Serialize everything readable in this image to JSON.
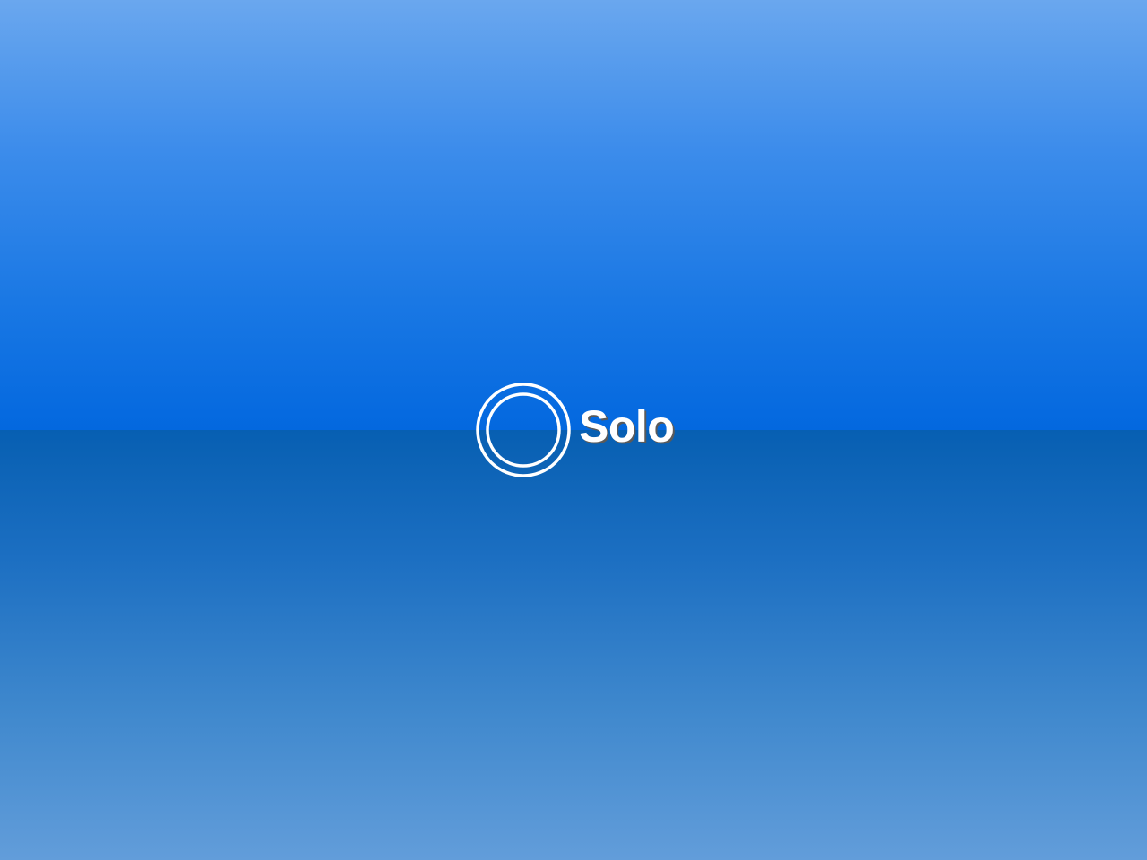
{
  "brand": {
    "name": "Solo"
  },
  "icons": {
    "logo": "solo-ring-logo-icon"
  },
  "colors": {
    "sky_top": "#6aa7ee",
    "sky_horizon": "#0368df",
    "ground_horizon": "#075fb2",
    "ground_bottom": "#629dda",
    "logo": "#ffffff"
  }
}
